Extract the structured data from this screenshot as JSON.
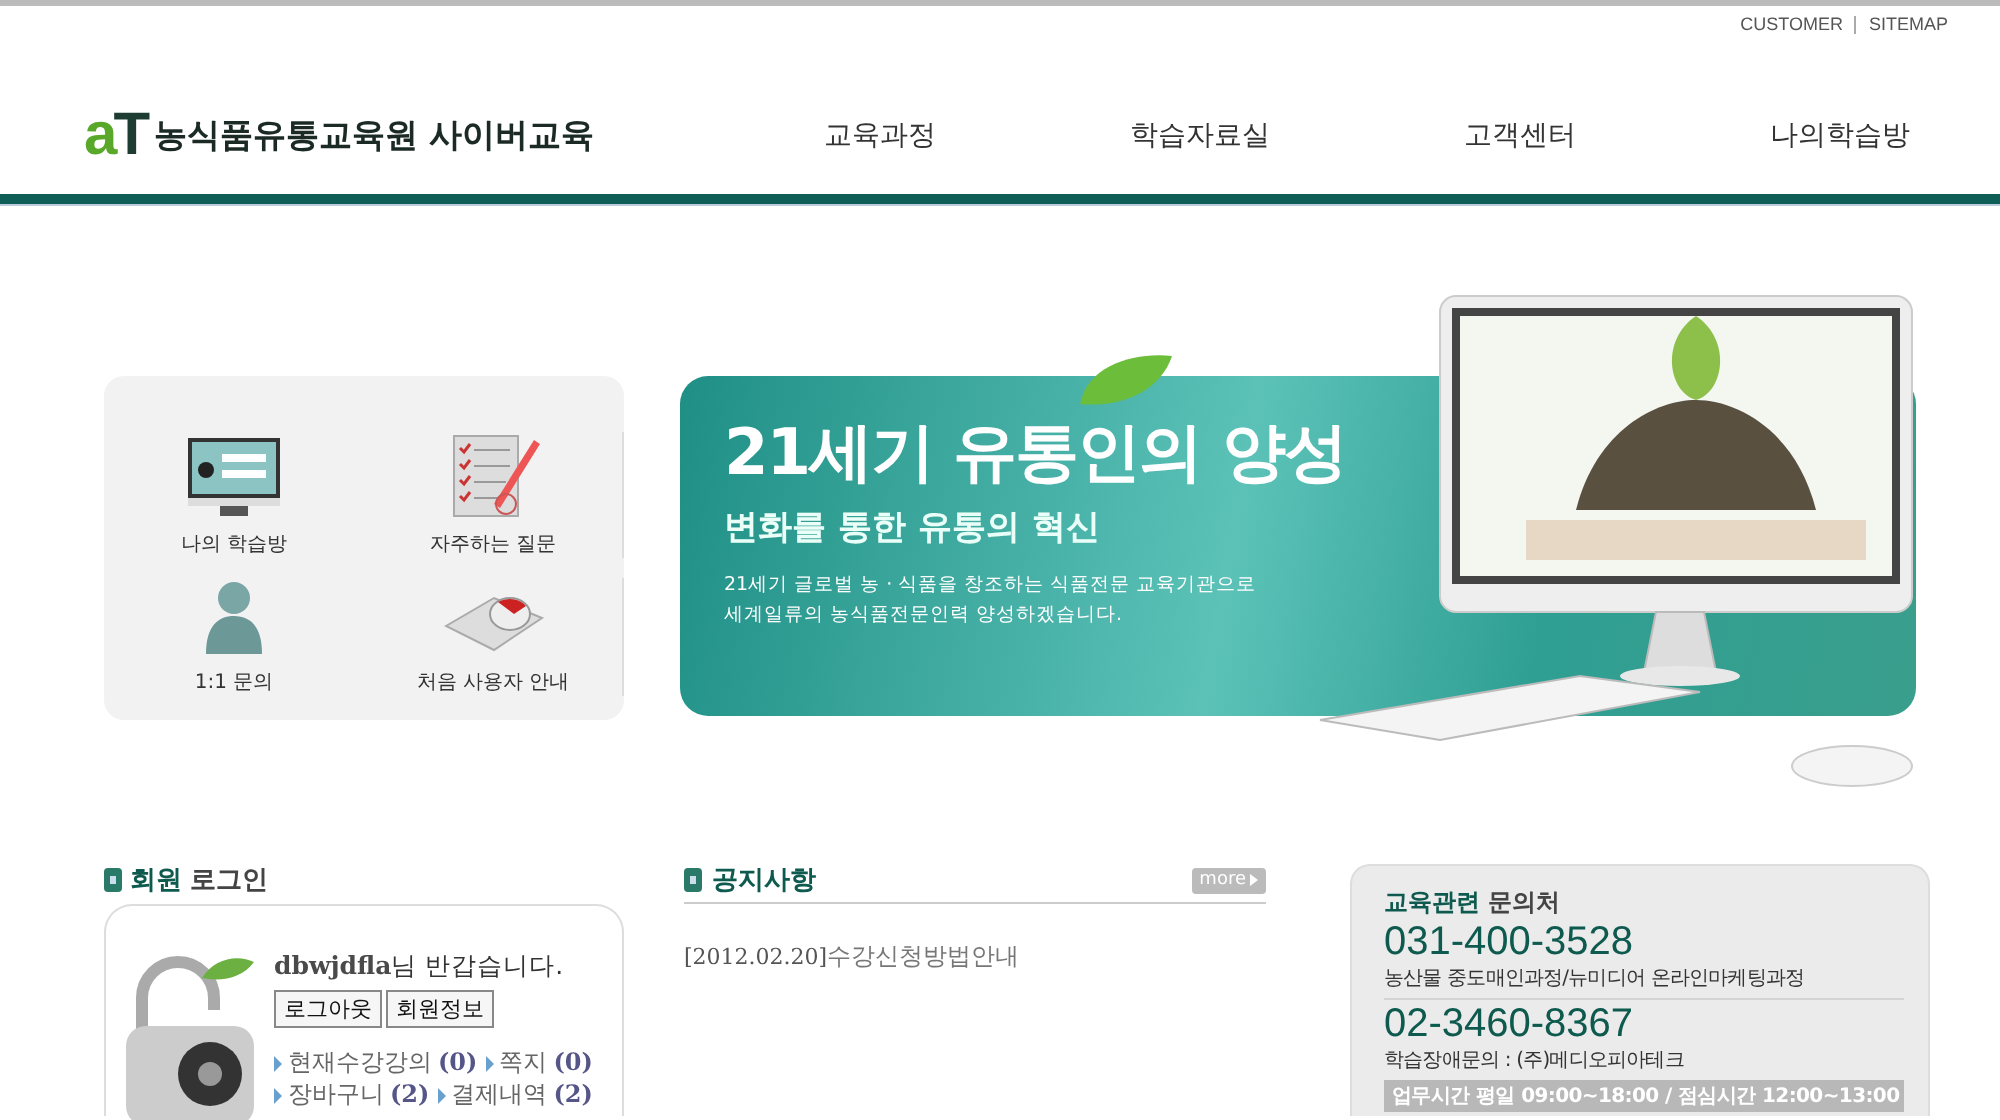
{
  "utility_links": [
    {
      "label": "CUSTOMER"
    },
    {
      "label": "SITEMAP"
    }
  ],
  "logo": {
    "mark_a": "a",
    "mark_t": "T",
    "title": "농식품유통교육원 사이버교육"
  },
  "nav": [
    {
      "label": "교육과정"
    },
    {
      "label": "학습자료실"
    },
    {
      "label": "고객센터"
    },
    {
      "label": "나의학습방"
    }
  ],
  "quick_menu": [
    {
      "label": "나의 학습방",
      "kind": "monitor"
    },
    {
      "label": "자주하는 질문",
      "kind": "document"
    },
    {
      "label": "1:1 문의",
      "kind": "person"
    },
    {
      "label": "처음 사용자 안내",
      "kind": "mouse"
    }
  ],
  "banner": {
    "headline": "21세기 유통인의 양성",
    "subheadline": "변화를 통한 유통의 혁신",
    "description": "21세기 글로벌 농 · 식품을 창조하는 식품전문 교육기관으로 세계일류의 농식품전문인력 양성하겠습니다."
  },
  "login": {
    "title_strong": "회원",
    "title_rest": "로그인",
    "user": "dbwjdfla",
    "greeting": "님 반갑습니다.",
    "buttons": [
      "로그아웃",
      "회원정보"
    ],
    "links": [
      {
        "label": "현재수강강의",
        "count": "(0)"
      },
      {
        "label": "쪽지",
        "count": "(0)"
      },
      {
        "label": "장바구니",
        "count": "(2)"
      },
      {
        "label": "결제내역",
        "count": "(2)"
      }
    ]
  },
  "notice": {
    "title": "공지사항",
    "more": "more",
    "items": [
      {
        "date": "[2012.02.20]",
        "title": "수강신청방법안내"
      }
    ]
  },
  "contact": {
    "title_strong": "교육관련",
    "title_rest": "문의처",
    "entries": [
      {
        "phone": "031-400-3528",
        "description": "농산물 중도매인과정/뉴미디어 온라인마케팅과정"
      },
      {
        "phone": "02-3460-8367",
        "description": "학습장애문의 : (주)메디오피아테크"
      }
    ],
    "hours": "업무시간 평일 09:00~18:00 / 점심시간 12:00~13:00"
  }
}
